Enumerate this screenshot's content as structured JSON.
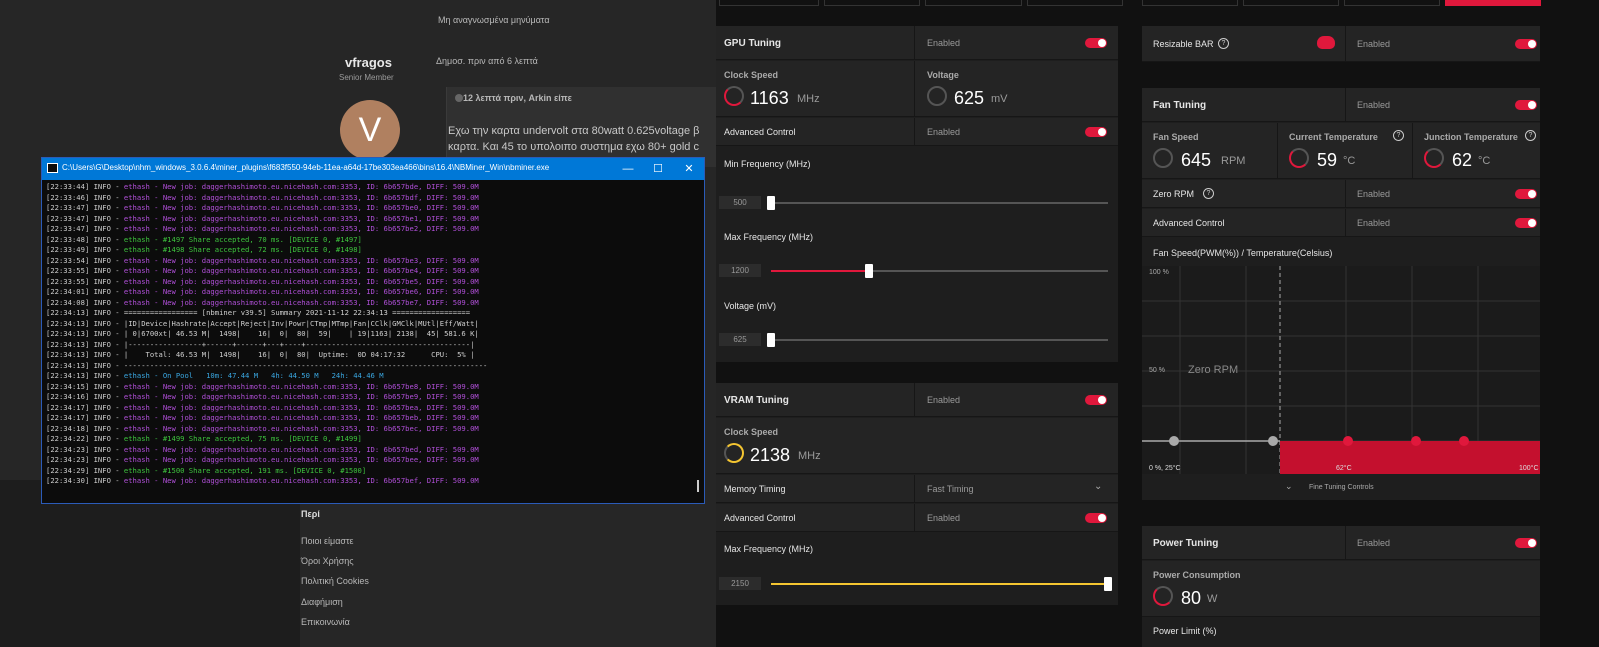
{
  "forum": {
    "unread": "Μη αναγνωσμένα μηνύματα",
    "username": "vfragos",
    "user_rank": "Senior Member",
    "avatar_letter": "V",
    "posted": "Δημοσ. πριν από 6 λεπτά",
    "quote_head": "12 λεπτά πριν, Arkin είπε",
    "post_line1": "Εχω την καρτα undervolt στα 80watt 0.625voltage β",
    "post_line2": "καρτα. Και 45 το υπολοιπο συστημα εχω 80+ gold c",
    "footer_head": "Περί",
    "footer_links": [
      "Ποιοι είμαστε",
      "Όροι Χρήσης",
      "Πολιτική Cookies",
      "Διαφήμιση",
      "Επικοινωνία"
    ]
  },
  "terminal": {
    "title": "C:\\Users\\G\\Desktop\\nhm_windows_3.0.6.4\\miner_plugins\\f683f550-94eb-11ea-a64d-17be303ea466\\bins\\16.4\\NBMiner_Win\\nbminer.exe",
    "lines": [
      {
        "t": "[22:33:44] INFO - ethash - New job: daggerhashimoto.eu.nicehash.com:3353, ID: 6b657bde, DIFF: 509.0M",
        "c": "#b04fd8"
      },
      {
        "t": "[22:33:46] INFO - ethash - New job: daggerhashimoto.eu.nicehash.com:3353, ID: 6b657bdf, DIFF: 509.0M",
        "c": "#b04fd8"
      },
      {
        "t": "[22:33:47] INFO - ethash - New job: daggerhashimoto.eu.nicehash.com:3353, ID: 6b657be0, DIFF: 509.0M",
        "c": "#b04fd8"
      },
      {
        "t": "[22:33:47] INFO - ethash - New job: daggerhashimoto.eu.nicehash.com:3353, ID: 6b657be1, DIFF: 509.0M",
        "c": "#b04fd8"
      },
      {
        "t": "[22:33:47] INFO - ethash - New job: daggerhashimoto.eu.nicehash.com:3353, ID: 6b657be2, DIFF: 509.0M",
        "c": "#b04fd8"
      },
      {
        "t": "[22:33:48] INFO - ethash - #1497 Share accepted, 70 ms. [DEVICE 0, #1497]",
        "c": "#3ec43e"
      },
      {
        "t": "[22:33:49] INFO - ethash - #1498 Share accepted, 72 ms. [DEVICE 0, #1498]",
        "c": "#3ec43e"
      },
      {
        "t": "[22:33:54] INFO - ethash - New job: daggerhashimoto.eu.nicehash.com:3353, ID: 6b657be3, DIFF: 509.0M",
        "c": "#b04fd8"
      },
      {
        "t": "[22:33:55] INFO - ethash - New job: daggerhashimoto.eu.nicehash.com:3353, ID: 6b657be4, DIFF: 509.0M",
        "c": "#b04fd8"
      },
      {
        "t": "[22:33:55] INFO - ethash - New job: daggerhashimoto.eu.nicehash.com:3353, ID: 6b657be5, DIFF: 509.0M",
        "c": "#b04fd8"
      },
      {
        "t": "[22:34:01] INFO - ethash - New job: daggerhashimoto.eu.nicehash.com:3353, ID: 6b657be6, DIFF: 509.0M",
        "c": "#b04fd8"
      },
      {
        "t": "[22:34:08] INFO - ethash - New job: daggerhashimoto.eu.nicehash.com:3353, ID: 6b657be7, DIFF: 509.0M",
        "c": "#b04fd8"
      },
      {
        "t": "[22:34:13] INFO - ================= [nbminer v39.5] Summary 2021-11-12 22:34:13 ==================",
        "c": "#d0d0d0"
      },
      {
        "t": "[22:34:13] INFO - |ID|Device|Hashrate|Accept|Reject|Inv|Powr|CTmp|MTmp|Fan|CClk|GMClk|MUtl|Eff/Watt|",
        "c": "#d0d0d0"
      },
      {
        "t": "[22:34:13] INFO - | 0|6700xt| 46.53 M|  1498|    16|  0|  80|  59|    | 19|1163| 2138|  45| 581.6 K|",
        "c": "#d0d0d0"
      },
      {
        "t": "[22:34:13] INFO - |-----------------+------+------+---+----+--------------------------------------|",
        "c": "#d0d0d0"
      },
      {
        "t": "[22:34:13] INFO - |    Total: 46.53 M|  1498|    16|  0|  80|  Uptime:  0D 04:17:32      CPU:  5% |",
        "c": "#d0d0d0"
      },
      {
        "t": "[22:34:13] INFO - ------------------------------------------------------------------------------------",
        "c": "#d0d0d0"
      },
      {
        "t": "[22:34:13] INFO - ethash - On Pool   10m: 47.44 M   4h: 44.50 M   24h: 44.46 M",
        "c": "#3aa6e0"
      },
      {
        "t": "[22:34:15] INFO - ethash - New job: daggerhashimoto.eu.nicehash.com:3353, ID: 6b657be8, DIFF: 509.0M",
        "c": "#b04fd8"
      },
      {
        "t": "[22:34:16] INFO - ethash - New job: daggerhashimoto.eu.nicehash.com:3353, ID: 6b657be9, DIFF: 509.0M",
        "c": "#b04fd8"
      },
      {
        "t": "[22:34:17] INFO - ethash - New job: daggerhashimoto.eu.nicehash.com:3353, ID: 6b657bea, DIFF: 509.0M",
        "c": "#b04fd8"
      },
      {
        "t": "[22:34:17] INFO - ethash - New job: daggerhashimoto.eu.nicehash.com:3353, ID: 6b657beb, DIFF: 509.0M",
        "c": "#b04fd8"
      },
      {
        "t": "[22:34:18] INFO - ethash - New job: daggerhashimoto.eu.nicehash.com:3353, ID: 6b657bec, DIFF: 509.0M",
        "c": "#b04fd8"
      },
      {
        "t": "[22:34:22] INFO - ethash - #1499 Share accepted, 75 ms. [DEVICE 0, #1499]",
        "c": "#3ec43e"
      },
      {
        "t": "[22:34:23] INFO - ethash - New job: daggerhashimoto.eu.nicehash.com:3353, ID: 6b657bed, DIFF: 509.0M",
        "c": "#b04fd8"
      },
      {
        "t": "[22:34:23] INFO - ethash - New job: daggerhashimoto.eu.nicehash.com:3353, ID: 6b657bee, DIFF: 509.0M",
        "c": "#b04fd8"
      },
      {
        "t": "[22:34:29] INFO - ethash - #1500 Share accepted, 191 ms. [DEVICE 0, #1500]",
        "c": "#3ec43e"
      },
      {
        "t": "[22:34:30] INFO - ethash - New job: daggerhashimoto.eu.nicehash.com:3353, ID: 6b657bef, DIFF: 509.0M",
        "c": "#b04fd8"
      }
    ]
  },
  "gpu": {
    "header": "GPU Tuning",
    "header_state": "Enabled",
    "clock_label": "Clock Speed",
    "clock_value": "1163",
    "clock_unit": "MHz",
    "voltage_label": "Voltage",
    "voltage_value": "625",
    "voltage_unit": "mV",
    "advanced_label": "Advanced Control",
    "advanced_state": "Enabled",
    "min_freq_label": "Min Frequency (MHz)",
    "min_freq_value": "500",
    "min_freq_level": 0.0,
    "max_freq_label": "Max Frequency (MHz)",
    "max_freq_value": "1200",
    "max_freq_level": 0.29,
    "volt_label": "Voltage (mV)",
    "volt_value": "625",
    "volt_level": 0.0
  },
  "vram": {
    "header": "VRAM Tuning",
    "header_state": "Enabled",
    "clock_label": "Clock Speed",
    "clock_value": "2138",
    "clock_unit": "MHz",
    "timing_label": "Memory Timing",
    "timing_value": "Fast Timing",
    "advanced_label": "Advanced Control",
    "advanced_state": "Enabled",
    "max_freq_label": "Max Frequency (MHz)",
    "max_freq_value": "2150",
    "max_freq_level": 1.0
  },
  "rbar": {
    "label": "Resizable BAR",
    "state": "Enabled"
  },
  "fan": {
    "header": "Fan Tuning",
    "header_state": "Enabled",
    "speed_label": "Fan Speed",
    "speed_value": "645",
    "speed_unit": "RPM",
    "cur_temp_label": "Current Temperature",
    "cur_temp_value": "59",
    "cur_temp_unit": "°C",
    "junc_label": "Junction Temperature",
    "junc_value": "62",
    "junc_unit": "°C",
    "zero_label": "Zero RPM",
    "zero_state": "Enabled",
    "adv_label": "Advanced Control",
    "adv_state": "Enabled",
    "curve_title": "Fan Speed(PWM(%)) / Temperature(Celsius)",
    "y_top": "100 %",
    "y_mid": "50 %",
    "origin": "0 %, 25°C",
    "x_mid": "62°C",
    "x_end": "100°C",
    "zero_rpm_text": "Zero RPM",
    "fine_tuning": "Fine Tuning Controls"
  },
  "power": {
    "header": "Power Tuning",
    "header_state": "Enabled",
    "consumption_label": "Power Consumption",
    "consumption_value": "80",
    "consumption_unit": "W",
    "limit_label": "Power Limit (%)"
  },
  "colors": {
    "accent": "#e0183c",
    "vram": "#f4c531",
    "bg": "#111111",
    "panel": "#242424"
  }
}
